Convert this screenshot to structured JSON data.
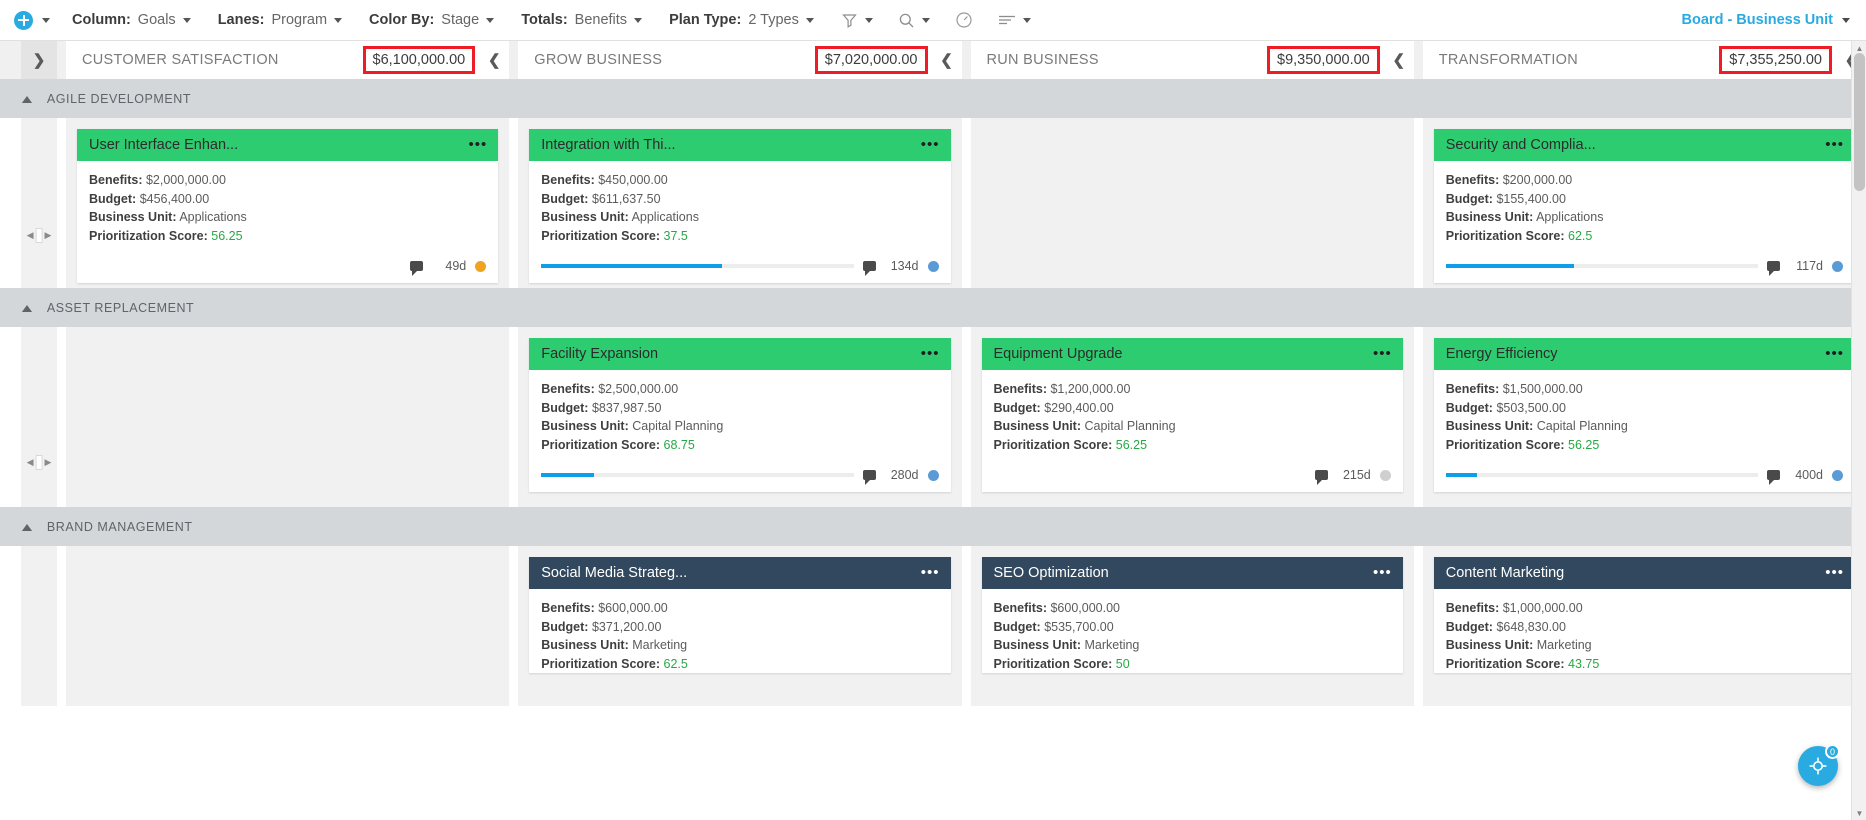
{
  "toolbar": {
    "add_icon": "plus-circle-icon",
    "add_caret": "chevron-down-icon",
    "menus": [
      {
        "label": "Column:",
        "value": "Goals"
      },
      {
        "label": "Lanes:",
        "value": "Program"
      },
      {
        "label": "Color By:",
        "value": "Stage"
      },
      {
        "label": "Totals:",
        "value": "Benefits"
      },
      {
        "label": "Plan Type:",
        "value": "2 Types"
      }
    ],
    "icons": [
      {
        "name": "filter-icon"
      },
      {
        "name": "search-icon"
      },
      {
        "name": "gauge-icon"
      },
      {
        "name": "list-view-icon"
      }
    ],
    "board_switch": {
      "label": "Board - Business Unit",
      "icon": "chevron-down-icon",
      "color": "#29abe2"
    }
  },
  "columns": [
    {
      "title": "CUSTOMER SATISFACTION",
      "total": "$6,100,000.00",
      "highlighted": true,
      "collapse_icon": "chevron-left-icon"
    },
    {
      "title": "GROW BUSINESS",
      "total": "$7,020,000.00",
      "highlighted": true,
      "collapse_icon": "chevron-left-icon"
    },
    {
      "title": "RUN BUSINESS",
      "total": "$9,350,000.00",
      "highlighted": true,
      "collapse_icon": "chevron-left-icon"
    },
    {
      "title": "TRANSFORMATION",
      "total": "$7,355,250.00",
      "highlighted": true,
      "collapse_icon": "chevron-left-icon"
    }
  ],
  "expand_left_icon": "chevron-right-icon",
  "field_labels": {
    "benefits": "Benefits:",
    "budget": "Budget:",
    "business_unit": "Business Unit:",
    "score": "Prioritization Score:"
  },
  "lanes": [
    {
      "title": "AGILE DEVELOPMENT",
      "collapse_icon": "chevron-up-icon",
      "cells": [
        {
          "card": {
            "name": "User Interface Enhan...",
            "header_color": "green",
            "benefits": "$2,000,000.00",
            "budget": "$456,400.00",
            "business_unit": "Applications",
            "score": "56.25",
            "progress": 0,
            "days": "49d",
            "dot_color": "#f0a31e",
            "menu_icon": "more-options-icon",
            "comment_icon": "comment-icon"
          }
        },
        {
          "card": {
            "name": "Integration with Thi...",
            "header_color": "green",
            "benefits": "$450,000.00",
            "budget": "$611,637.50",
            "business_unit": "Applications",
            "score": "37.5",
            "progress": 58,
            "days": "134d",
            "dot_color": "#5b9bd5",
            "menu_icon": "more-options-icon",
            "comment_icon": "comment-icon"
          }
        },
        {
          "card": null
        },
        {
          "card": {
            "name": "Security and Complia...",
            "header_color": "green",
            "benefits": "$200,000.00",
            "budget": "$155,400.00",
            "business_unit": "Applications",
            "score": "62.5",
            "progress": 41,
            "days": "117d",
            "dot_color": "#5b9bd5",
            "menu_icon": "more-options-icon",
            "comment_icon": "comment-icon"
          }
        }
      ]
    },
    {
      "title": "ASSET REPLACEMENT",
      "collapse_icon": "chevron-up-icon",
      "cells": [
        {
          "card": null
        },
        {
          "card": {
            "name": "Facility Expansion",
            "header_color": "green",
            "benefits": "$2,500,000.00",
            "budget": "$837,987.50",
            "business_unit": "Capital Planning",
            "score": "68.75",
            "progress": 17,
            "days": "280d",
            "dot_color": "#5b9bd5",
            "menu_icon": "more-options-icon",
            "comment_icon": "comment-icon"
          }
        },
        {
          "card": {
            "name": "Equipment Upgrade",
            "header_color": "green",
            "benefits": "$1,200,000.00",
            "budget": "$290,400.00",
            "business_unit": "Capital Planning",
            "score": "56.25",
            "progress": 0,
            "days": "215d",
            "dot_color": "#cfcfcf",
            "menu_icon": "more-options-icon",
            "comment_icon": "comment-icon"
          }
        },
        {
          "card": {
            "name": "Energy Efficiency",
            "header_color": "green",
            "benefits": "$1,500,000.00",
            "budget": "$503,500.00",
            "business_unit": "Capital Planning",
            "score": "56.25",
            "progress": 10,
            "days": "400d",
            "dot_color": "#5b9bd5",
            "menu_icon": "more-options-icon",
            "comment_icon": "comment-icon"
          }
        }
      ]
    },
    {
      "title": "BRAND MANAGEMENT",
      "collapse_icon": "chevron-up-icon",
      "cells": [
        {
          "card": null
        },
        {
          "card": {
            "name": "Social Media Strateg...",
            "header_color": "dark",
            "benefits": "$600,000.00",
            "budget": "$371,200.00",
            "business_unit": "Marketing",
            "score": "62.5",
            "progress": 0,
            "days": "",
            "dot_color": "",
            "menu_icon": "more-options-icon",
            "comment_icon": "comment-icon"
          }
        },
        {
          "card": {
            "name": "SEO Optimization",
            "header_color": "dark",
            "benefits": "$600,000.00",
            "budget": "$535,700.00",
            "business_unit": "Marketing",
            "score": "50",
            "progress": 0,
            "days": "",
            "dot_color": "",
            "menu_icon": "more-options-icon",
            "comment_icon": "comment-icon"
          }
        },
        {
          "card": {
            "name": "Content Marketing",
            "header_color": "dark",
            "benefits": "$1,000,000.00",
            "budget": "$648,830.00",
            "business_unit": "Marketing",
            "score": "43.75",
            "progress": 0,
            "days": "",
            "dot_color": "",
            "menu_icon": "more-options-icon",
            "comment_icon": "comment-icon"
          }
        }
      ]
    }
  ],
  "fab": {
    "icon": "help-assistant-icon",
    "badge": "0"
  }
}
